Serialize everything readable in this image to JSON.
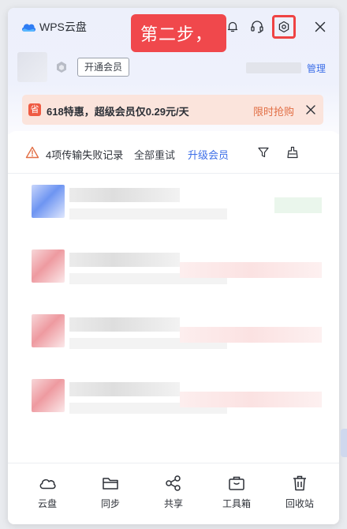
{
  "app": {
    "title": "WPS云盘"
  },
  "callout": {
    "text": "第二步，"
  },
  "user": {
    "vip_button": "开通会员",
    "manage_link": "管理"
  },
  "promo": {
    "tag": "省",
    "text": "618特惠，超级会员仅0.29元/天",
    "cta": "限时抢购"
  },
  "transfer": {
    "fail_text": "4项传输失败记录",
    "retry_all": "全部重试",
    "upgrade": "升级会员"
  },
  "nav": [
    {
      "label": "云盘",
      "icon": "cloud-icon"
    },
    {
      "label": "同步",
      "icon": "folder-icon"
    },
    {
      "label": "共享",
      "icon": "share-icon"
    },
    {
      "label": "工具箱",
      "icon": "toolbox-icon"
    },
    {
      "label": "回收站",
      "icon": "trash-icon"
    }
  ],
  "colors": {
    "accent": "#3d6fe8",
    "callout": "#f0484c",
    "promo_bg": "#fbe4dc",
    "warning": "#e26f45"
  }
}
